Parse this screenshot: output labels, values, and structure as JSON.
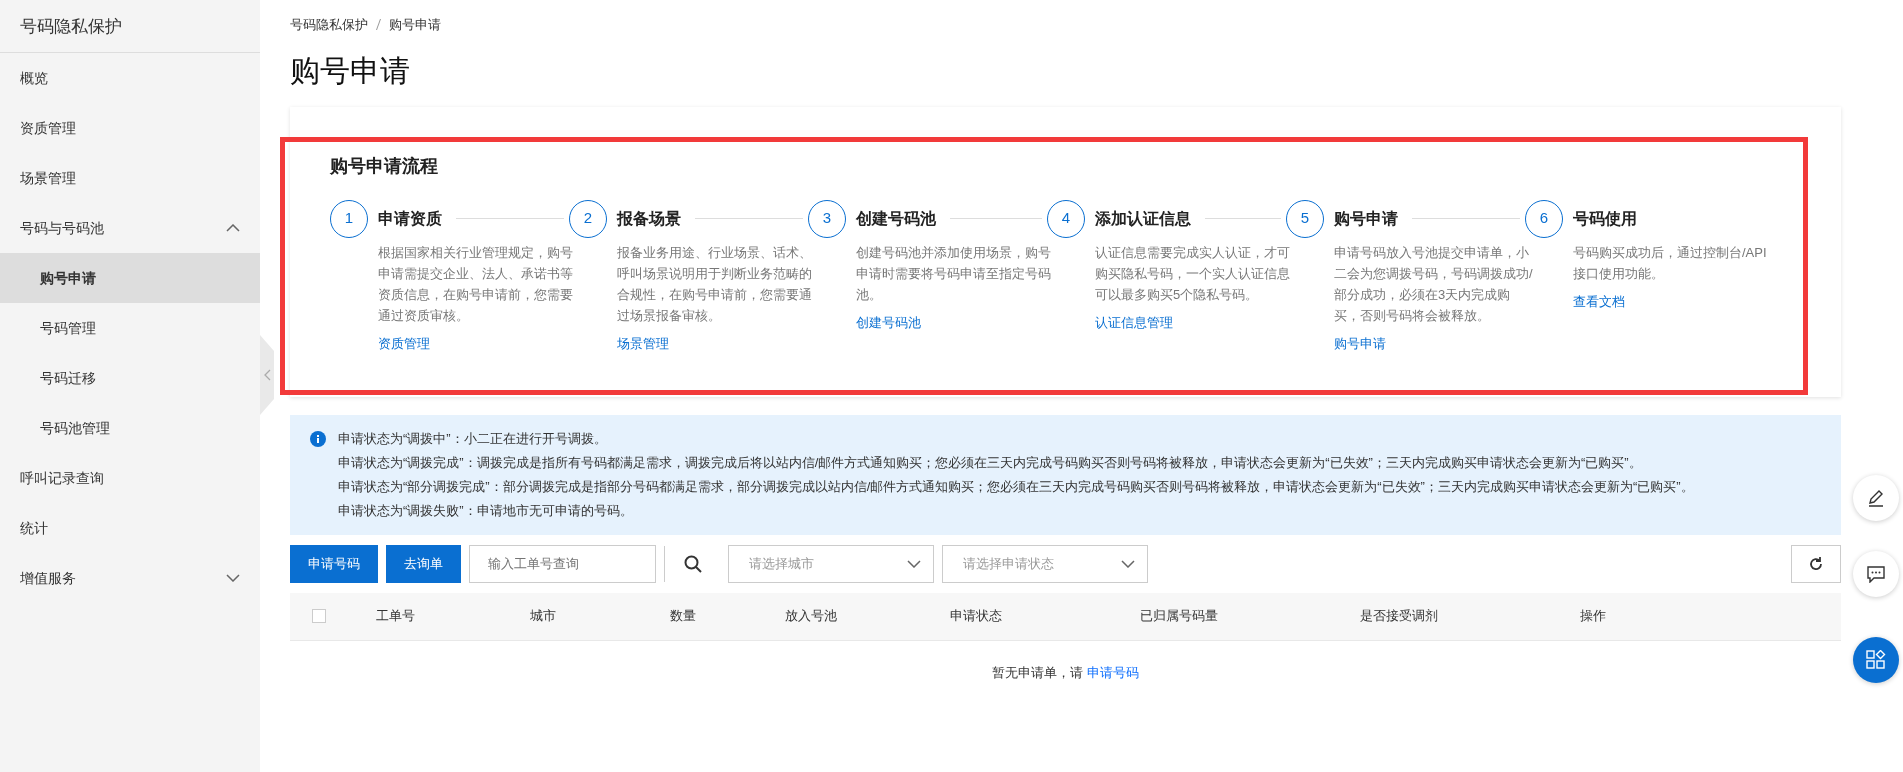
{
  "sidebar": {
    "title": "号码隐私保护",
    "items": [
      {
        "label": "概览",
        "selected": false
      },
      {
        "label": "资质管理",
        "selected": false
      },
      {
        "label": "场景管理",
        "selected": false
      },
      {
        "label": "号码与号码池",
        "selected": false,
        "expanded": true,
        "children": [
          {
            "label": "购号申请",
            "selected": true
          },
          {
            "label": "号码管理",
            "selected": false
          },
          {
            "label": "号码迁移",
            "selected": false
          },
          {
            "label": "号码池管理",
            "selected": false
          }
        ]
      },
      {
        "label": "呼叫记录查询",
        "selected": false
      },
      {
        "label": "统计",
        "selected": false
      },
      {
        "label": "增值服务",
        "selected": false,
        "expanded": false
      }
    ]
  },
  "breadcrumb": [
    "号码隐私保护",
    "购号申请"
  ],
  "page_title": "购号申请",
  "process": {
    "title": "购号申请流程",
    "steps": [
      {
        "number": "1",
        "title": "申请资质",
        "description": "根据国家相关行业管理规定，购号申请需提交企业、法人、承诺书等资质信息，在购号申请前，您需要通过资质审核。",
        "link": "资质管理"
      },
      {
        "number": "2",
        "title": "报备场景",
        "description": "报备业务用途、行业场景、话术、呼叫场景说明用于判断业务范畴的合规性，在购号申请前，您需要通过场景报备审核。",
        "link": "场景管理"
      },
      {
        "number": "3",
        "title": "创建号码池",
        "description": "创建号码池并添加使用场景，购号申请时需要将号码申请至指定号码池。",
        "link": "创建号码池"
      },
      {
        "number": "4",
        "title": "添加认证信息",
        "description": "认证信息需要完成实人认证，才可购买隐私号码，一个实人认证信息可以最多购买5个隐私号码。",
        "link": "认证信息管理"
      },
      {
        "number": "5",
        "title": "购号申请",
        "description": "申请号码放入号池提交申请单，小二会为您调拨号码，号码调拨成功/部分成功，必须在3天内完成购买，否则号码将会被释放。",
        "link": "购号申请"
      },
      {
        "number": "6",
        "title": "号码使用",
        "description": "号码购买成功后，通过控制台/API接口使用功能。",
        "link": "查看文档"
      }
    ]
  },
  "notice": [
    "申请状态为“调拨中”：小二正在进行开号调拨。",
    "申请状态为“调拨完成”：调拨完成是指所有号码都满足需求，调拨完成后将以站内信/邮件方式通知购买；您必须在三天内完成号码购买否则号码将被释放，申请状态会更新为“已失效”；三天内完成购买申请状态会更新为“已购买”。",
    "申请状态为“部分调拨完成”：部分调拨完成是指部分号码都满足需求，部分调拨完成以站内信/邮件方式通知购买；您必须在三天内完成号码购买否则号码将被释放，申请状态会更新为“已失效”；三天内完成购买申请状态会更新为“已购买”。",
    "申请状态为“调拨失败”：申请地市无可申请的号码。"
  ],
  "toolbar": {
    "buttons": [
      "申请号码",
      "去询单"
    ],
    "search": {
      "placeholder": "输入工单号查询"
    },
    "selects": [
      {
        "placeholder": "请选择城市"
      },
      {
        "placeholder": "请选择申请状态"
      }
    ]
  },
  "table": {
    "select_all": {
      "checked": false
    },
    "columns": [
      "工单号",
      "城市",
      "数量",
      "放入号池",
      "申请状态",
      "已归属号码量",
      "是否接受调剂",
      "操作"
    ],
    "empty": {
      "text": "暂无申请单，请",
      "link": "申请号码"
    }
  }
}
